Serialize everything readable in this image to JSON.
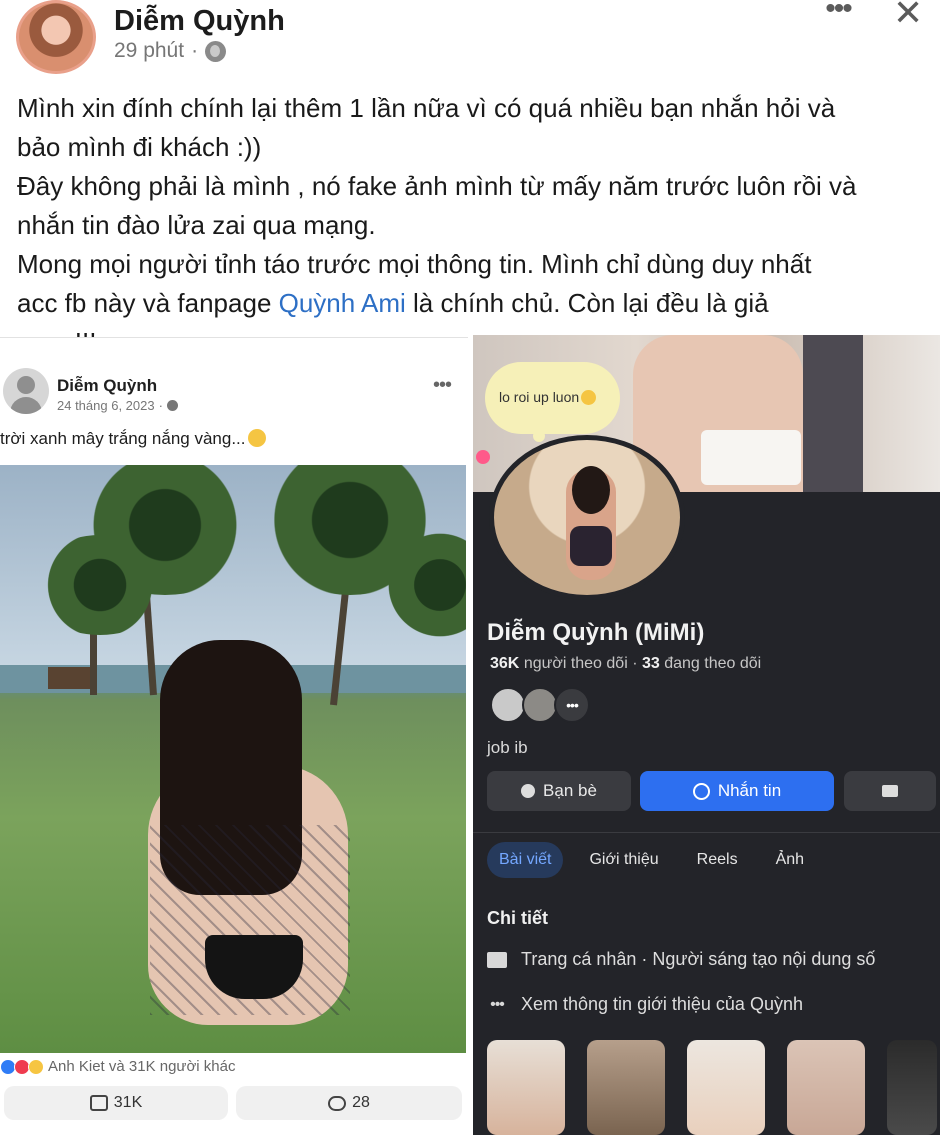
{
  "post": {
    "author": "Diễm Quỳnh",
    "time": "29 phút",
    "separator": "·",
    "more_icon": "more-horizontal-icon",
    "close_icon": "close-icon",
    "text_lines": [
      "Mình xin đính chính lại thêm 1 lần nữa vì có quá nhiều bạn nhắn hỏi và",
      "bảo mình đi khách :))",
      "Đây không phải là mình , nó fake ảnh mình từ mấy năm trước luôn rồi và",
      "nhắn tin đào lửa zai qua mạng.",
      "Mong mọi người tỉnh táo trước mọi thông tin. Mình chỉ dùng duy nhất",
      "acc fb này và fanpage ",
      "Quỳnh Ami",
      " là chính chủ. Còn lại đều là giả",
      "mạo !!!"
    ],
    "link_color": "#2d6fc5"
  },
  "left_screenshot": {
    "author": "Diễm Quỳnh",
    "date": "24 tháng 6, 2023",
    "separator": "·",
    "caption": "trời xanh mây trắng nắng vàng...",
    "reactions_text": "Anh Kiet và 31K người khác",
    "likes": "31K",
    "comments": "28"
  },
  "right_screenshot": {
    "bubble_text": "lo roi up luon",
    "name": "Diễm Quỳnh (MiMi)",
    "followers_count": "36K",
    "followers_label": "người theo dõi",
    "stats_sep": "·",
    "following_count": "33",
    "following_label": "đang theo dõi",
    "bio": "job ib",
    "friends_button": "Bạn bè",
    "message_button": "Nhắn tin",
    "tabs": [
      "Bài viết",
      "Giới thiệu",
      "Reels",
      "Ảnh"
    ],
    "section_title": "Chi tiết",
    "detail_profile": "Trang cá nhân",
    "detail_profile_rest": " · Người sáng tạo nội dung số",
    "detail_more": "Xem thông tin giới thiệu của Quỳnh",
    "accent_color": "#2d6ff0"
  }
}
